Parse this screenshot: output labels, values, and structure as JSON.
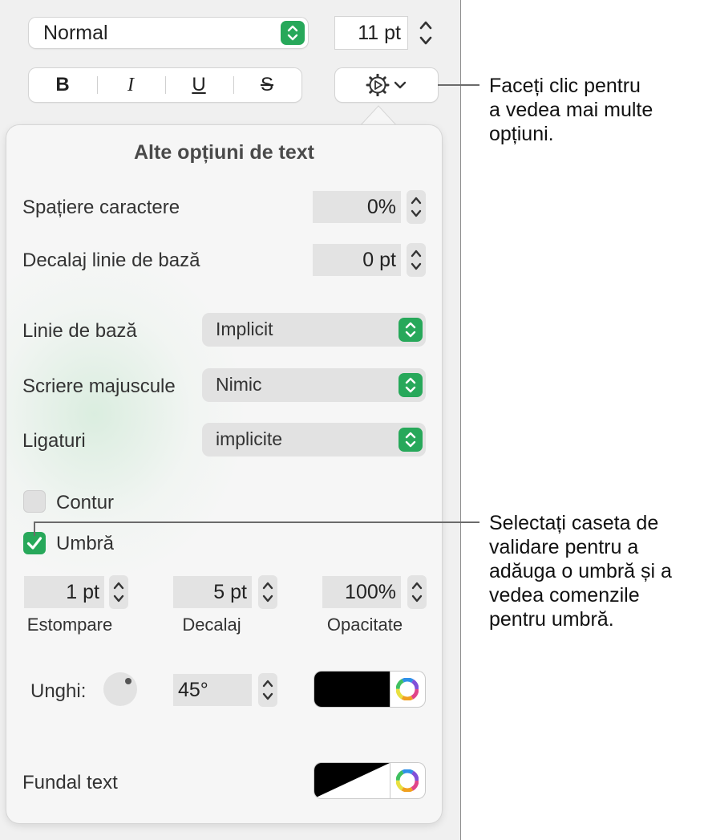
{
  "toolbar": {
    "paragraph_style": "Normal",
    "font_size": "11 pt",
    "bold_label": "B",
    "italic_label": "I",
    "underline_label": "U",
    "strikethrough_label": "S",
    "gear_icon": "gear-icon",
    "chevron_icon": "chevron-down-icon"
  },
  "popover": {
    "title": "Alte opțiuni de text",
    "character_spacing": {
      "label": "Spațiere caractere",
      "value": "0%"
    },
    "baseline_shift": {
      "label": "Decalaj linie de bază",
      "value": "0 pt"
    },
    "baseline": {
      "label": "Linie de bază",
      "value": "Implicit"
    },
    "capitalization": {
      "label": "Scriere majuscule",
      "value": "Nimic"
    },
    "ligatures": {
      "label": "Ligaturi",
      "value": "implicite"
    },
    "outline": {
      "label": "Contur",
      "checked": false
    },
    "shadow": {
      "label": "Umbră",
      "checked": true,
      "blur": {
        "value": "1 pt",
        "label": "Estompare"
      },
      "offset": {
        "value": "5 pt",
        "label": "Decalaj"
      },
      "opacity": {
        "value": "100%",
        "label": "Opacitate"
      },
      "angle_label": "Unghi:",
      "angle_value": "45°",
      "color": "#000000"
    },
    "text_background": {
      "label": "Fundal text"
    }
  },
  "callouts": {
    "more_options": "Faceți clic pentru a vedea mai multe opțiuni.",
    "more_options_lines": [
      "Faceți clic pentru",
      "a vedea mai multe",
      "opțiuni."
    ],
    "shadow_lines": [
      "Selectați caseta de",
      "validare pentru a",
      "adăuga o umbră și a",
      "vedea comenzile",
      "pentru umbră."
    ]
  },
  "colors": {
    "accent_green": "#27a85a",
    "field_gray": "#e3e3e3"
  }
}
